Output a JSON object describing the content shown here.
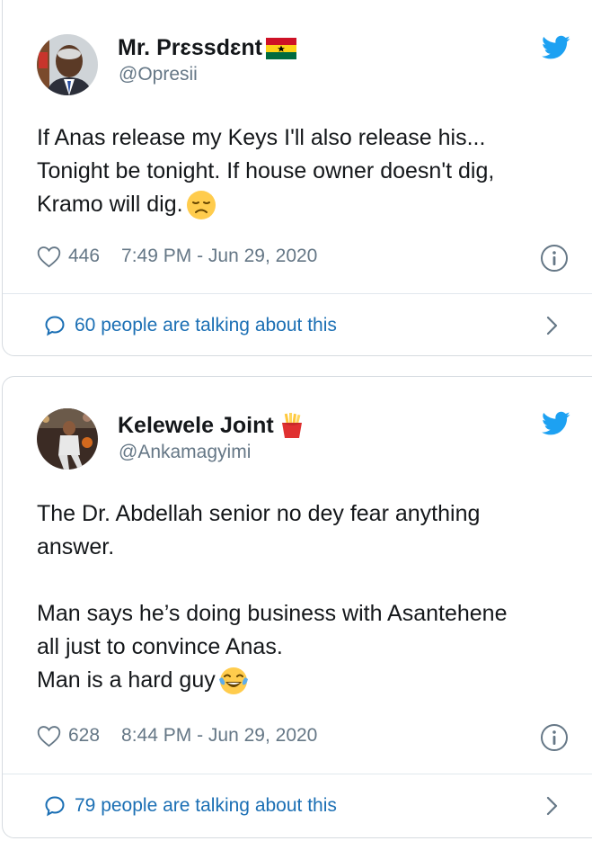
{
  "tweets": [
    {
      "display_name": "Mr. Prɛssdɛnt",
      "name_badge_icon": "ghana-flag-icon",
      "handle": "@Opresii",
      "lines": [
        "If Anas release my Keys I'll also release his...",
        "Tonight be tonight. If house owner doesn't dig,",
        "Kramo will dig."
      ],
      "trailing_emoji_icon": "disappointed-face-emoji",
      "likes": "446",
      "timestamp": "7:49 PM - Jun 29, 2020",
      "talking": "60 people are talking about this"
    },
    {
      "display_name": "Kelewele Joint",
      "name_badge_icon": "fries-icon",
      "handle": "@Ankamagyimi",
      "lines": [
        "The Dr. Abdellah senior no dey fear anything",
        "answer.",
        "",
        "Man says he’s doing business with Asantehene",
        "all just to convince Anas.",
        "Man is a hard guy"
      ],
      "trailing_emoji_icon": "tears-of-joy-emoji",
      "likes": "628",
      "timestamp": "8:44 PM - Jun 29, 2020",
      "talking": "79 people are talking about this"
    }
  ],
  "colors": {
    "twitter_blue": "#1da1f2",
    "link_blue": "#1b6fb4",
    "secondary_text": "#657786",
    "border": "#d6dbe0"
  }
}
